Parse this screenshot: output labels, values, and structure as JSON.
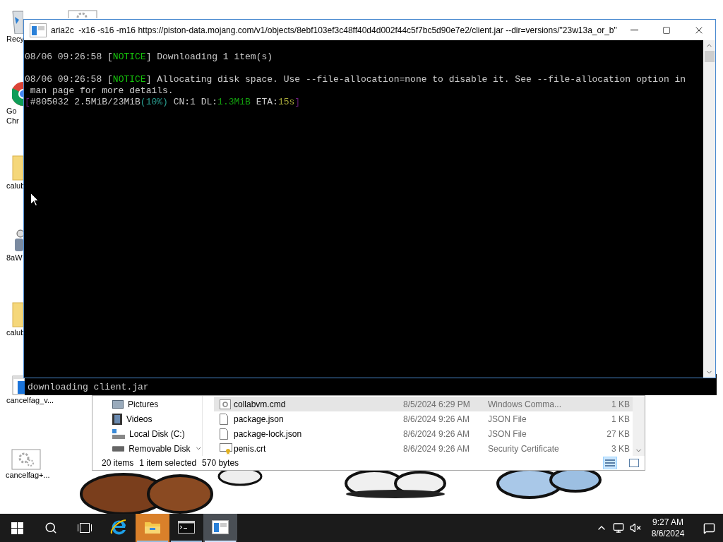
{
  "desktop": {
    "icons": [
      {
        "kind": "recycle",
        "lines": [
          "Recy"
        ]
      },
      {
        "kind": "chrome",
        "lines": [
          "Go",
          "Chr"
        ]
      },
      {
        "kind": "folder",
        "lines": [
          "calub"
        ]
      },
      {
        "kind": "figure",
        "lines": [
          "8aW"
        ]
      },
      {
        "kind": "folder",
        "lines": [
          "calub"
        ]
      },
      {
        "kind": "window",
        "lines": [
          "cancelfag_v..."
        ]
      },
      {
        "kind": "gears",
        "lines": [
          "cancelfag+..."
        ]
      }
    ]
  },
  "console": {
    "title": "aria2c  -x16 -s16 -m16 https://piston-data.mojang.com/v1/objects/8ebf103ef3c48ff40d4d002f44c5f7bc5d90e7e2/client.jar --dir=versions/\"23w13a_or_b\"",
    "blocks": [
      [
        {
          "segments": [
            {
              "kind": "text",
              "text": "08/06 09:26:58 ["
            },
            {
              "kind": "notice",
              "text": "NOTICE"
            },
            {
              "kind": "text",
              "text": "] Downloading 1 item(s)"
            }
          ]
        }
      ],
      [
        {
          "segments": [
            {
              "kind": "text",
              "text": "08/06 09:26:58 ["
            },
            {
              "kind": "notice",
              "text": "NOTICE"
            },
            {
              "kind": "text",
              "text": "] Allocating disk space. Use --file-allocation=none to disable it. See --file-allocation option in"
            }
          ]
        },
        {
          "segments": [
            {
              "kind": "text",
              "text": " man page for more details."
            }
          ]
        },
        {
          "segments": [
            {
              "kind": "bracket",
              "text": "["
            },
            {
              "kind": "text",
              "text": "#805032 2.5MiB/23MiB"
            },
            {
              "kind": "percent",
              "text": "(10%)"
            },
            {
              "kind": "text",
              "text": " CN:1 DL:"
            },
            {
              "kind": "speed",
              "text": "1.3MiB"
            },
            {
              "kind": "text",
              "text": " ETA:"
            },
            {
              "kind": "eta",
              "text": "15s"
            },
            {
              "kind": "bracket",
              "text": "]"
            }
          ]
        }
      ]
    ]
  },
  "background_console": {
    "line": "downloading client.jar"
  },
  "explorer": {
    "nav": [
      {
        "kind": "pictures",
        "label": "Pictures"
      },
      {
        "kind": "videos",
        "label": "Videos"
      },
      {
        "kind": "disk",
        "label": "Local Disk (C:)"
      },
      {
        "kind": "removable",
        "label": "Removable Disk"
      }
    ],
    "files": [
      {
        "kind": "cmd",
        "name": "collabvm.cmd",
        "date": "8/5/2024 6:29 PM",
        "type": "Windows Comma...",
        "size": "1 KB",
        "selected": true
      },
      {
        "kind": "doc",
        "name": "package.json",
        "date": "8/6/2024 9:26 AM",
        "type": "JSON File",
        "size": "1 KB",
        "selected": false
      },
      {
        "kind": "doc",
        "name": "package-lock.json",
        "date": "8/6/2024 9:26 AM",
        "type": "JSON File",
        "size": "27 KB",
        "selected": false
      },
      {
        "kind": "cert",
        "name": "penis.crt",
        "date": "8/6/2024 9:26 AM",
        "type": "Security Certificate",
        "size": "3 KB",
        "selected": false
      }
    ],
    "status": [
      "20 items",
      "1 item selected",
      "570 bytes"
    ],
    "views": [
      {
        "kind": "details",
        "selected": true
      },
      {
        "kind": "tiles",
        "selected": false
      }
    ]
  },
  "taskbar": {
    "apps": [
      {
        "kind": "ie",
        "open": false,
        "selected": false,
        "flashing": false
      },
      {
        "kind": "explorer",
        "open": true,
        "selected": false,
        "flashing": true
      },
      {
        "kind": "console",
        "open": true,
        "selected": false,
        "flashing": false
      },
      {
        "kind": "window",
        "open": true,
        "selected": true,
        "flashing": false
      }
    ],
    "time": "9:27 AM",
    "date": "8/6/2024",
    "volume_muted": true
  }
}
